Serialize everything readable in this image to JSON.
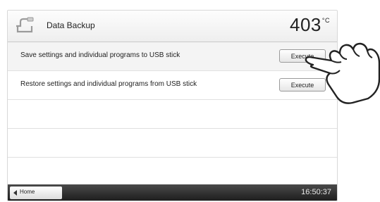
{
  "header": {
    "title": "Data Backup",
    "temperature": "403",
    "temperature_unit": "°C",
    "icon": "data-backup-icon"
  },
  "rows": [
    {
      "label": "Save settings and individual programs to USB stick",
      "button": "Execute"
    },
    {
      "label": "Restore settings and individual programs from USB stick",
      "button": "Execute"
    }
  ],
  "footer": {
    "home_label": "Home",
    "time": "16:50:37"
  },
  "colors": {
    "footer_bg": "#2b2b2b",
    "row_divider": "#e0e0e0"
  }
}
